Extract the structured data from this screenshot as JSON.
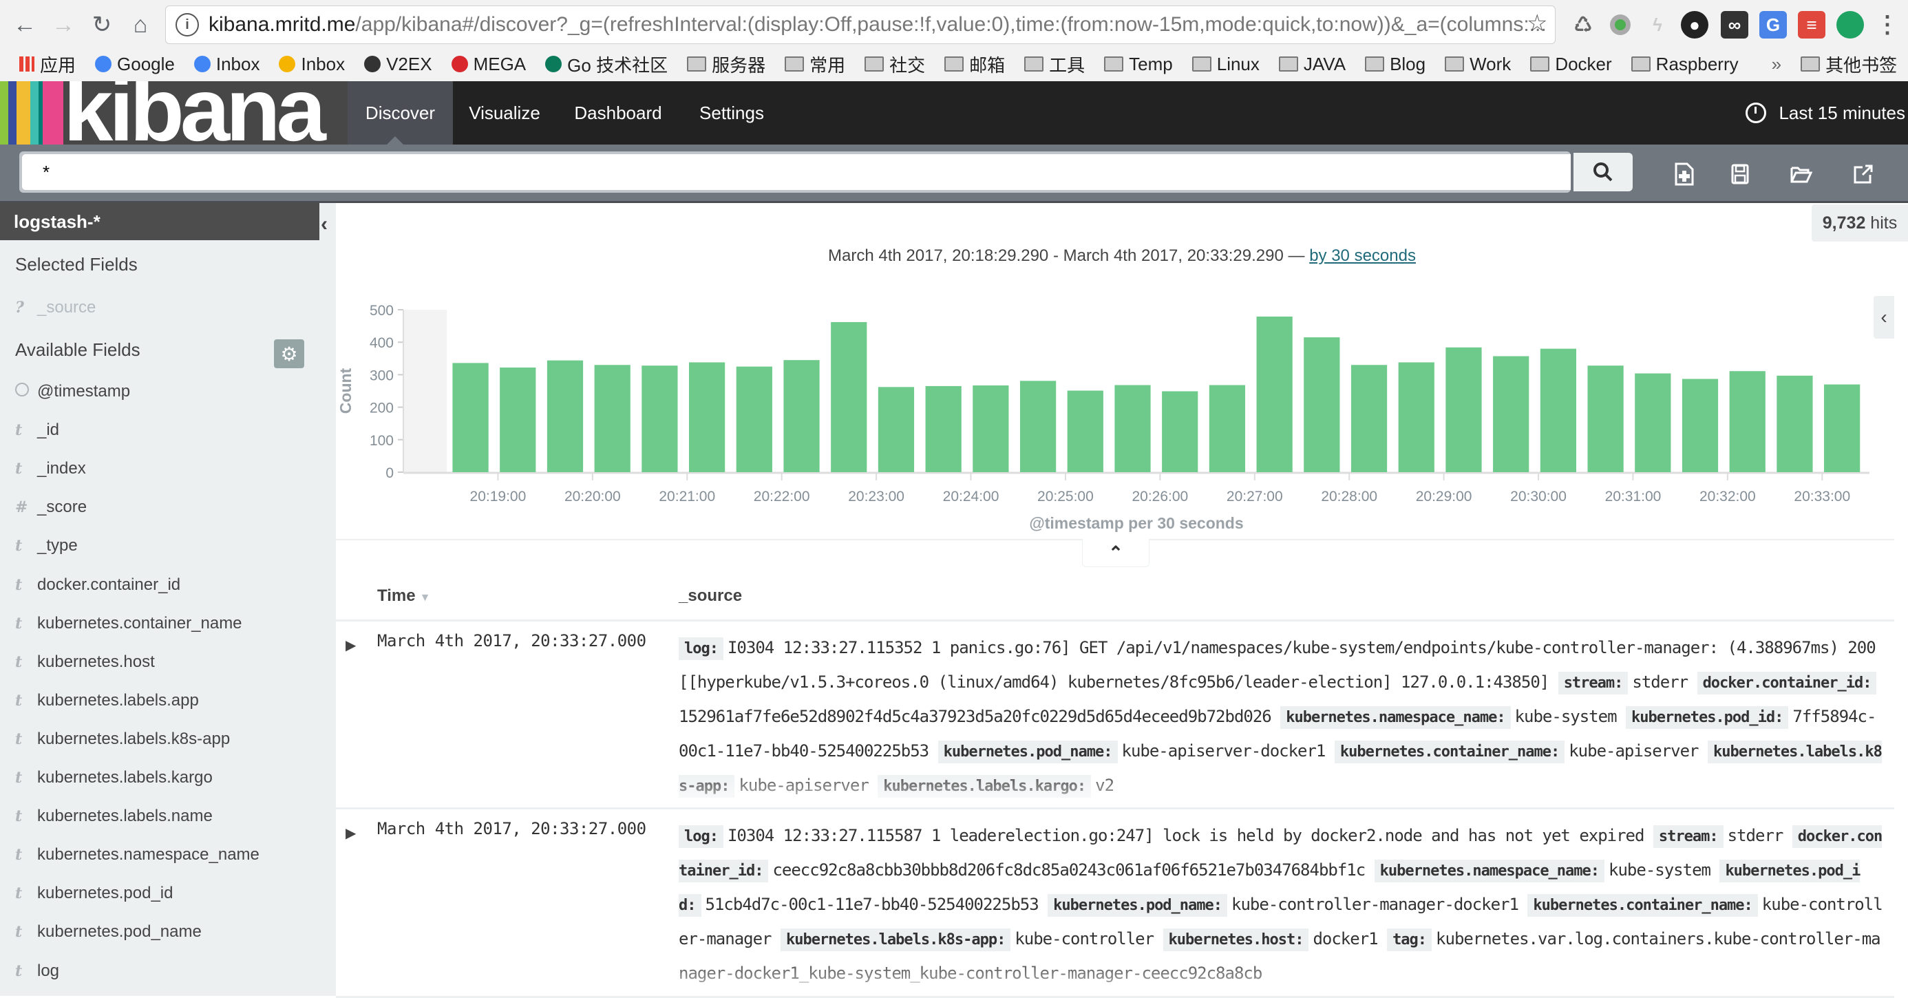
{
  "browser": {
    "url_host": "kibana.mritd.me",
    "url_path": "/app/kibana#/discover?_g=(refreshInterval:(display:Off,pause:!f,value:0),time:(from:now-15m,mode:quick,to:now))&_a=(columns:...",
    "bookmarks": [
      {
        "label": "应用",
        "icon": "apps-grid-icon"
      },
      {
        "label": "Google",
        "icon": "google-icon"
      },
      {
        "label": "Inbox",
        "icon": "inbox-icon"
      },
      {
        "label": "Inbox",
        "icon": "inbox-envelope-icon"
      },
      {
        "label": "V2EX",
        "icon": "v2ex-icon"
      },
      {
        "label": "MEGA",
        "icon": "mega-icon"
      },
      {
        "label": "Go 技术社区",
        "icon": "gopher-icon"
      },
      {
        "label": "服务器",
        "icon": "folder-icon"
      },
      {
        "label": "常用",
        "icon": "folder-icon"
      },
      {
        "label": "社交",
        "icon": "folder-icon"
      },
      {
        "label": "邮箱",
        "icon": "folder-icon"
      },
      {
        "label": "工具",
        "icon": "folder-icon"
      },
      {
        "label": "Temp",
        "icon": "folder-icon"
      },
      {
        "label": "Linux",
        "icon": "folder-icon"
      },
      {
        "label": "JAVA",
        "icon": "folder-icon"
      },
      {
        "label": "Blog",
        "icon": "folder-icon"
      },
      {
        "label": "Work",
        "icon": "folder-icon"
      },
      {
        "label": "Docker",
        "icon": "folder-icon"
      },
      {
        "label": "Raspberry",
        "icon": "folder-icon"
      }
    ],
    "more_bookmarks": "»",
    "other_bookmarks": "其他书签"
  },
  "kibana": {
    "logo": "kibana",
    "tabs": [
      "Discover",
      "Visualize",
      "Dashboard",
      "Settings"
    ],
    "active_tab": "Discover",
    "time_range": "Last 15 minutes",
    "query": "*",
    "index_pattern": "logstash-*",
    "hits_count": "9,732",
    "hits_label": "hits"
  },
  "sidebar": {
    "selected_title": "Selected Fields",
    "selected_fields": [
      {
        "type": "?",
        "name": "_source"
      }
    ],
    "available_title": "Available Fields",
    "available_fields": [
      {
        "type": "clock",
        "name": "@timestamp"
      },
      {
        "type": "t",
        "name": "_id"
      },
      {
        "type": "t",
        "name": "_index"
      },
      {
        "type": "#",
        "name": "_score"
      },
      {
        "type": "t",
        "name": "_type"
      },
      {
        "type": "t",
        "name": "docker.container_id"
      },
      {
        "type": "t",
        "name": "kubernetes.container_name"
      },
      {
        "type": "t",
        "name": "kubernetes.host"
      },
      {
        "type": "t",
        "name": "kubernetes.labels.app"
      },
      {
        "type": "t",
        "name": "kubernetes.labels.k8s-app"
      },
      {
        "type": "t",
        "name": "kubernetes.labels.kargo"
      },
      {
        "type": "t",
        "name": "kubernetes.labels.name"
      },
      {
        "type": "t",
        "name": "kubernetes.namespace_name"
      },
      {
        "type": "t",
        "name": "kubernetes.pod_id"
      },
      {
        "type": "t",
        "name": "kubernetes.pod_name"
      },
      {
        "type": "t",
        "name": "log"
      }
    ]
  },
  "range_header": {
    "text": "March 4th 2017, 20:18:29.290 - March 4th 2017, 20:33:29.290 —",
    "interval_link": "by 30 seconds"
  },
  "chart_data": {
    "type": "bar",
    "title": "",
    "xlabel": "@timestamp per 30 seconds",
    "ylabel": "Count",
    "ylim": [
      0,
      500
    ],
    "yticks": [
      0,
      100,
      200,
      300,
      400,
      500
    ],
    "xticks": [
      "20:19:00",
      "20:20:00",
      "20:21:00",
      "20:22:00",
      "20:23:00",
      "20:24:00",
      "20:25:00",
      "20:26:00",
      "20:27:00",
      "20:28:00",
      "20:29:00",
      "20:30:00",
      "20:31:00",
      "20:32:00",
      "20:33:00"
    ],
    "x": [
      "20:18:30",
      "20:19:00",
      "20:19:30",
      "20:20:00",
      "20:20:30",
      "20:21:00",
      "20:21:30",
      "20:22:00",
      "20:22:30",
      "20:23:00",
      "20:23:30",
      "20:24:00",
      "20:24:30",
      "20:25:00",
      "20:25:30",
      "20:26:00",
      "20:26:30",
      "20:27:00",
      "20:27:30",
      "20:28:00",
      "20:28:30",
      "20:29:00",
      "20:29:30",
      "20:30:00",
      "20:30:30",
      "20:31:00",
      "20:31:30",
      "20:32:00",
      "20:32:30",
      "20:33:00"
    ],
    "values": [
      336,
      322,
      344,
      330,
      328,
      338,
      325,
      345,
      462,
      262,
      265,
      267,
      281,
      251,
      268,
      249,
      268,
      479,
      415,
      330,
      338,
      384,
      357,
      380,
      328,
      304,
      287,
      311,
      297,
      270
    ],
    "color": "#6eca8a",
    "grid": false,
    "legend": "none"
  },
  "table": {
    "columns": [
      "Time",
      "_source"
    ],
    "rows": [
      {
        "time": "March 4th 2017, 20:33:27.000",
        "fields": [
          {
            "k": "log:",
            "v": "I0304 12:33:27.115352 1 panics.go:76] GET /api/v1/namespaces/kube-system/endpoints/kube-controller-manager: (4.388967ms) 200 [[hyperkube/v1.5.3+coreos.0 (linux/amd64) kubernetes/8fc95b6/leader-election] 127.0.0.1:43850]"
          },
          {
            "k": "stream:",
            "v": "stderr"
          },
          {
            "k": "docker.container_id:",
            "v": "152961af7fe6e52d8902f4d5c4a37923d5a20fc0229d5d65d4eceed9b72bd026"
          },
          {
            "k": "kubernetes.namespace_name:",
            "v": "kube-system"
          },
          {
            "k": "kubernetes.pod_id:",
            "v": "7ff5894c-00c1-11e7-bb40-525400225b53"
          },
          {
            "k": "kubernetes.pod_name:",
            "v": "kube-apiserver-docker1"
          },
          {
            "k": "kubernetes.container_name:",
            "v": "kube-apiserver"
          },
          {
            "k": "kubernetes.labels.k8s-app:",
            "v": "kube-apiserver"
          },
          {
            "k": "kubernetes.labels.kargo:",
            "v": "v2"
          }
        ]
      },
      {
        "time": "March 4th 2017, 20:33:27.000",
        "fields": [
          {
            "k": "log:",
            "v": "I0304 12:33:27.115587 1 leaderelection.go:247] lock is held by docker2.node and has not yet expired"
          },
          {
            "k": "stream:",
            "v": "stderr"
          },
          {
            "k": "docker.container_id:",
            "v": "ceecc92c8a8cbb30bbb8d206fc8dc85a0243c061af06f6521e7b0347684bbf1c"
          },
          {
            "k": "kubernetes.namespace_name:",
            "v": "kube-system"
          },
          {
            "k": "kubernetes.pod_id:",
            "v": "51cb4d7c-00c1-11e7-bb40-525400225b53"
          },
          {
            "k": "kubernetes.pod_name:",
            "v": "kube-controller-manager-docker1"
          },
          {
            "k": "kubernetes.container_name:",
            "v": "kube-controller-manager"
          },
          {
            "k": "kubernetes.labels.k8s-app:",
            "v": "kube-controller"
          },
          {
            "k": "kubernetes.host:",
            "v": "docker1"
          },
          {
            "k": "tag:",
            "v": "kubernetes.var.log.containers.kube-controller-manager-docker1_kube-system_kube-controller-manager-ceecc92c8a8cb"
          }
        ]
      }
    ]
  }
}
